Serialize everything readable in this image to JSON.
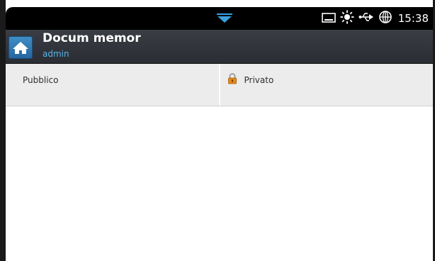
{
  "status": {
    "time": "15:38",
    "icons": [
      "screen-icon",
      "sun-icon",
      "usb-icon",
      "globe-icon"
    ]
  },
  "header": {
    "title": "Docum memor",
    "subtitle": "admin"
  },
  "tabs": [
    {
      "label": "Pubblico",
      "icon": ""
    },
    {
      "label": "Privato",
      "icon": "lock-icon"
    }
  ],
  "colors": {
    "status_bar": "#000000",
    "title_bar": "#2f3238",
    "home_button": "#2f78b4",
    "subtitle": "#59b6ea",
    "tab_bg": "#ececec"
  }
}
